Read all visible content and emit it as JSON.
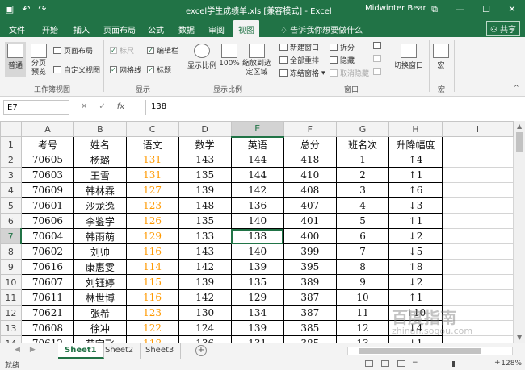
{
  "titlebar": {
    "save_icon": "save-icon",
    "undo_icon": "undo-icon",
    "redo_icon": "redo-icon",
    "title": "excel学生成绩单.xls [兼容模式] - Excel",
    "user": "Midwinter Bear",
    "restore_label": "⧉",
    "minimize_label": "—",
    "maximize_label": "☐",
    "close_label": "✕"
  },
  "tabs": [
    "文件",
    "开始",
    "插入",
    "页面布局",
    "公式",
    "数据",
    "审阅",
    "视图"
  ],
  "active_tab": "视图",
  "tell_me": "告诉我你想要做什么",
  "share": "共享",
  "ribbon": {
    "normal": "普通",
    "page_break": "分页预览",
    "page_layout": "页面布局",
    "custom_views": "自定义视图",
    "group_views": "工作簿视图",
    "ruler": "标尺",
    "gridlines": "网格线",
    "formula_bar": "编辑栏",
    "headings": "标题",
    "group_show": "显示",
    "zoom": "显示比例",
    "zoom_100": "100%",
    "zoom_selection": "缩放到选定区域",
    "group_zoom": "显示比例",
    "new_window": "新建窗口",
    "arrange_all": "全部重排",
    "freeze_panes": "冻结窗格",
    "split": "拆分",
    "hide": "隐藏",
    "unhide": "取消隐藏",
    "switch_windows": "切换窗口",
    "group_window": "窗口",
    "macros": "宏",
    "group_macros": "宏"
  },
  "formula_bar": {
    "name_box": "E7",
    "cancel": "✕",
    "enter": "✓",
    "fx": "fx",
    "value": "138"
  },
  "columns": [
    "A",
    "B",
    "C",
    "D",
    "E",
    "F",
    "G",
    "H",
    "I"
  ],
  "selected_column": "E",
  "selected_row": 7,
  "headers": [
    "考号",
    "姓名",
    "语文",
    "数学",
    "英语",
    "总分",
    "班名次",
    "升降幅度"
  ],
  "rows": [
    [
      "70605",
      "杨璐",
      "131",
      "143",
      "144",
      "418",
      "1",
      "↑4"
    ],
    [
      "70603",
      "王雪",
      "131",
      "135",
      "144",
      "410",
      "2",
      "↑1"
    ],
    [
      "70609",
      "韩林霖",
      "127",
      "139",
      "142",
      "408",
      "3",
      "↑6"
    ],
    [
      "70601",
      "沙龙逸",
      "123",
      "148",
      "136",
      "407",
      "4",
      "↓3"
    ],
    [
      "70606",
      "李鉴学",
      "126",
      "135",
      "140",
      "401",
      "5",
      "↑1"
    ],
    [
      "70604",
      "韩雨萌",
      "129",
      "133",
      "138",
      "400",
      "6",
      "↓2"
    ],
    [
      "70602",
      "刘帅",
      "116",
      "143",
      "140",
      "399",
      "7",
      "↓5"
    ],
    [
      "70616",
      "康惠雯",
      "114",
      "142",
      "139",
      "395",
      "8",
      "↑8"
    ],
    [
      "70607",
      "刘钰婷",
      "115",
      "139",
      "135",
      "389",
      "9",
      "↓2"
    ],
    [
      "70611",
      "林世博",
      "116",
      "142",
      "129",
      "387",
      "10",
      "↑1"
    ],
    [
      "70621",
      "张希",
      "123",
      "130",
      "134",
      "387",
      "11",
      "↑10"
    ],
    [
      "70608",
      "徐冲",
      "122",
      "124",
      "139",
      "385",
      "12",
      "↓4"
    ],
    [
      "70612",
      "苑宇飞",
      "118",
      "136",
      "131",
      "385",
      "13",
      "↓1"
    ]
  ],
  "sheets": [
    "Sheet1",
    "Sheet2",
    "Sheet3"
  ],
  "active_sheet": "Sheet1",
  "add_sheet": "+",
  "status": {
    "ready": "就绪",
    "zoom": "128%",
    "zoom_minus": "−",
    "zoom_plus": "+"
  },
  "watermark": {
    "text": "百度指南",
    "sub": "zhinan.sogou.com"
  },
  "colors": {
    "brand": "#217346",
    "chinese_score": "#ff9900"
  }
}
